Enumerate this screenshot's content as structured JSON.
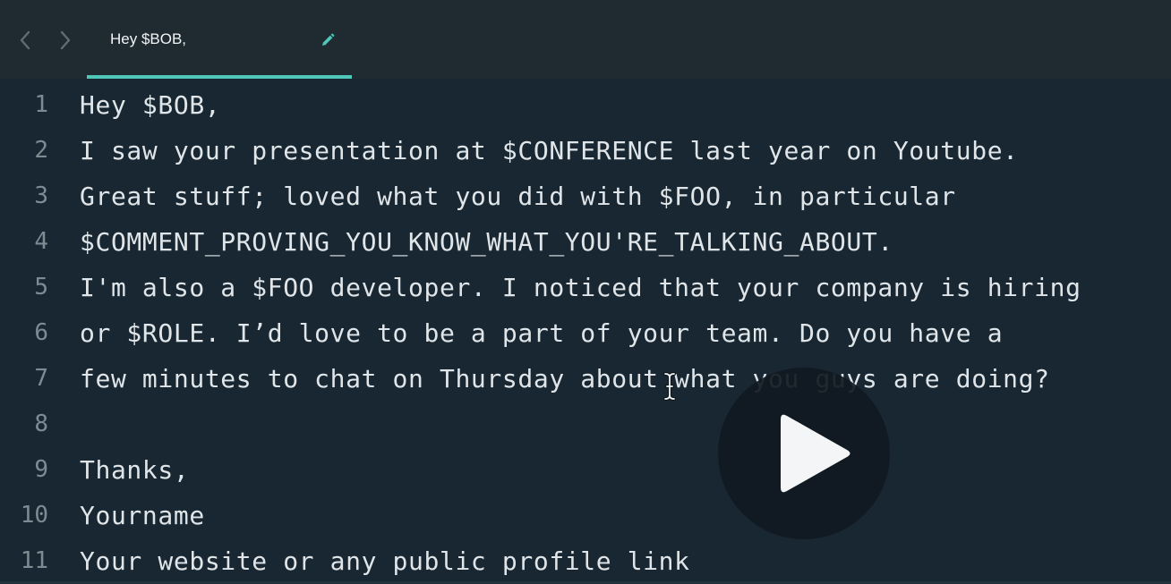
{
  "tab": {
    "title": "Hey $BOB,",
    "edit_icon": "pencil-icon"
  },
  "nav": {
    "back_icon": "chevron-left-icon",
    "forward_icon": "chevron-right-icon"
  },
  "editor": {
    "lines": [
      {
        "number": "1",
        "text": "Hey $BOB,"
      },
      {
        "number": "2",
        "text": "I saw your presentation at $CONFERENCE last year on Youtube."
      },
      {
        "number": "3",
        "text": "Great stuff; loved what you did with $FOO, in particular"
      },
      {
        "number": "4",
        "text": "$COMMENT_PROVING_YOU_KNOW_WHAT_YOU'RE_TALKING_ABOUT."
      },
      {
        "number": "5",
        "text": "I'm also a $FOO developer. I noticed that your company is hiring"
      },
      {
        "number": "6",
        "text": "or $ROLE. I’d love to be a part of your team. Do you have a"
      },
      {
        "number": "7",
        "text": "few minutes to chat on Thursday about what you guys are doing?"
      },
      {
        "number": "8",
        "text": ""
      },
      {
        "number": "9",
        "text": "Thanks,"
      },
      {
        "number": "10",
        "text": "Yourname"
      },
      {
        "number": "11",
        "text": "Your website or any public profile link"
      }
    ]
  },
  "overlay": {
    "play_icon": "play-icon",
    "cursor_icon": "text-cursor-icon"
  },
  "colors": {
    "editor_bg": "#182731",
    "tabbar_bg": "#1f2b31",
    "accent": "#4ec7b8",
    "text": "#dfe5e8",
    "line_number": "#7d8b92"
  }
}
